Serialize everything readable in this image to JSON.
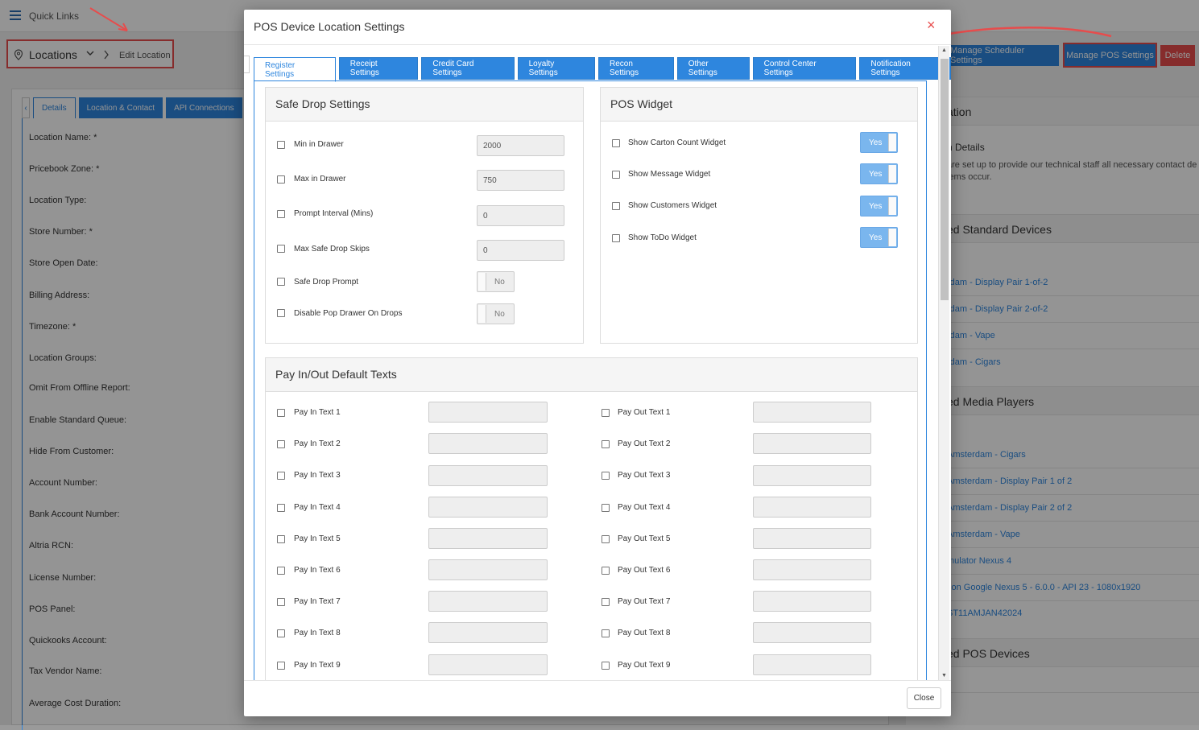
{
  "topbar": {
    "quick_links": "Quick Links"
  },
  "breadcrumb": {
    "locations": "Locations",
    "edit_location": "Edit Location"
  },
  "header_buttons": {
    "manage_scheduler": "Manage Scheduler Settings",
    "manage_pos": "Manage POS Settings",
    "delete": "Delete"
  },
  "left_panel": {
    "tabs": [
      "Details",
      "Location & Contact",
      "API Connections"
    ],
    "fields": [
      "Location Name: *",
      "Pricebook Zone: *",
      "Location Type:",
      "Store Number: *",
      "Store Open Date:",
      "Billing Address:",
      "Timezone: *",
      "Location Groups:",
      "Omit From Offline Report:",
      "Enable Standard Queue:",
      "Hide From Customer:",
      "Account Number:",
      "Bank Account Number:",
      "Altria RCN:",
      "License Number:",
      "POS Panel:",
      "Quickooks Account:",
      "Tax Vendor Name:",
      "Average Cost Duration:"
    ]
  },
  "right_panel": {
    "heading1": "ation",
    "details_title": "n Details",
    "details_text1": "are set up to provide our technical staff all necessary contact de",
    "details_text2": "lems occur.",
    "heading2": "ed Standard Devices",
    "standard_devices": [
      "rdam - Display Pair 1-of-2",
      "rdam - Display Pair 2-of-2",
      "rdam - Vape",
      "rdam - Cigars"
    ],
    "heading3": "ed Media Players",
    "media_players": [
      "Amsterdam - Cigars",
      "Amsterdam - Display Pair 1 of 2",
      "Amsterdam - Display Pair 2 of 2",
      "Amsterdam - Vape",
      "mulator Nexus 4",
      "tion Google Nexus 5 - 6.0.0 - API 23 - 1080x1920",
      "ST11AMJAN42024"
    ],
    "heading4": "ed POS Devices"
  },
  "modal": {
    "title": "POS Device Location Settings",
    "close_x": "×",
    "tabs": [
      "Register Settings",
      "Receipt Settings",
      "Credit Card Settings",
      "Loyalty Settings",
      "Recon Settings",
      "Other Settings",
      "Control Center Settings",
      "Notification Settings"
    ],
    "safe_drop": {
      "title": "Safe Drop Settings",
      "fields": [
        {
          "label": "Min in Drawer",
          "value": "2000"
        },
        {
          "label": "Max in Drawer",
          "value": "750"
        },
        {
          "label": "Prompt Interval (Mins)",
          "value": "0"
        },
        {
          "label": "Max Safe Drop Skips",
          "value": "0"
        }
      ],
      "toggles": [
        {
          "label": "Safe Drop Prompt",
          "value": "No"
        },
        {
          "label": "Disable Pop Drawer On Drops",
          "value": "No"
        }
      ]
    },
    "pos_widget": {
      "title": "POS Widget",
      "toggles": [
        {
          "label": "Show Carton Count Widget",
          "value": "Yes"
        },
        {
          "label": "Show Message Widget",
          "value": "Yes"
        },
        {
          "label": "Show Customers Widget",
          "value": "Yes"
        },
        {
          "label": "Show ToDo Widget",
          "value": "Yes"
        }
      ]
    },
    "pay_texts": {
      "title": "Pay In/Out Default Texts",
      "pay_in": [
        "Pay In Text 1",
        "Pay In Text 2",
        "Pay In Text 3",
        "Pay In Text 4",
        "Pay In Text 5",
        "Pay In Text 6",
        "Pay In Text 7",
        "Pay In Text 8",
        "Pay In Text 9"
      ],
      "pay_out": [
        "Pay Out Text 1",
        "Pay Out Text 2",
        "Pay Out Text 3",
        "Pay Out Text 4",
        "Pay Out Text 5",
        "Pay Out Text 6",
        "Pay Out Text 7",
        "Pay Out Text 8",
        "Pay Out Text 9"
      ]
    },
    "close_button": "Close"
  },
  "colors": {
    "primary": "#2e86de",
    "danger": "#e74c4c",
    "toggle_on": "#7ab6ee"
  }
}
